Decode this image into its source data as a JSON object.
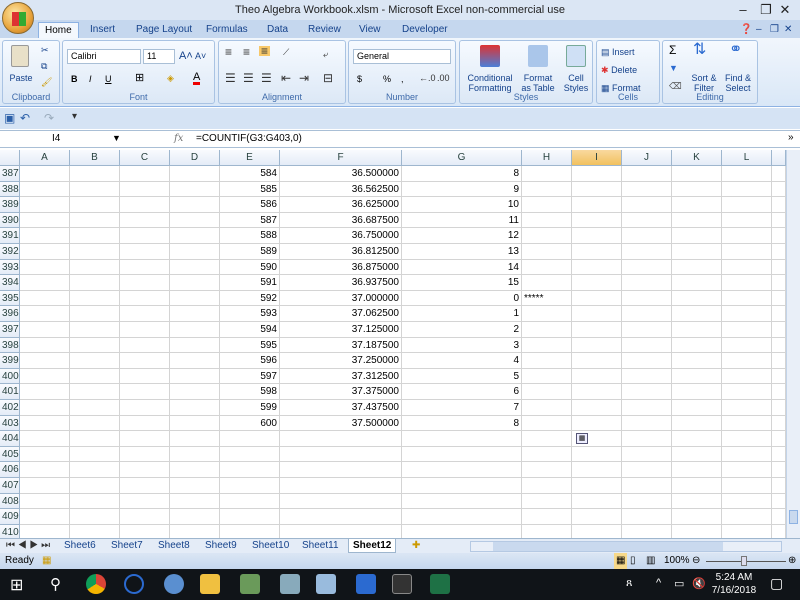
{
  "window": {
    "title": "Theo Algebra Workbook.xlsm - Microsoft Excel non-commercial use"
  },
  "ribbon": {
    "tabs": [
      "Home",
      "Insert",
      "Page Layout",
      "Formulas",
      "Data",
      "Review",
      "View",
      "Developer"
    ],
    "active_tab": "Home",
    "clipboard": {
      "label": "Clipboard",
      "paste": "Paste"
    },
    "font": {
      "label": "Font",
      "name": "Calibri",
      "size": "11",
      "bold": "B",
      "italic": "I",
      "underline": "U"
    },
    "alignment": {
      "label": "Alignment"
    },
    "number": {
      "label": "Number",
      "format": "General",
      "currency": "$",
      "percent": "%",
      "comma": ","
    },
    "styles": {
      "label": "Styles",
      "conditional": "Conditional Formatting",
      "format_table": "Format as Table",
      "cell_styles": "Cell Styles"
    },
    "cells": {
      "label": "Cells",
      "insert": "Insert",
      "delete": "Delete",
      "format": "Format"
    },
    "editing": {
      "label": "Editing",
      "sort": "Sort & Filter",
      "find": "Find & Select",
      "sum": "Σ"
    }
  },
  "formula_bar": {
    "name_box": "I4",
    "fx": "fx",
    "formula": "=COUNTIF(G3:G403,0)"
  },
  "columns": [
    "A",
    "B",
    "C",
    "D",
    "E",
    "F",
    "G",
    "H",
    "I",
    "J",
    "K",
    "L"
  ],
  "selected_column": "I",
  "rows": [
    {
      "n": "387",
      "E": "584",
      "F": "36.500000",
      "G": "8",
      "H": ""
    },
    {
      "n": "388",
      "E": "585",
      "F": "36.562500",
      "G": "9",
      "H": ""
    },
    {
      "n": "389",
      "E": "586",
      "F": "36.625000",
      "G": "10",
      "H": ""
    },
    {
      "n": "390",
      "E": "587",
      "F": "36.687500",
      "G": "11",
      "H": ""
    },
    {
      "n": "391",
      "E": "588",
      "F": "36.750000",
      "G": "12",
      "H": ""
    },
    {
      "n": "392",
      "E": "589",
      "F": "36.812500",
      "G": "13",
      "H": ""
    },
    {
      "n": "393",
      "E": "590",
      "F": "36.875000",
      "G": "14",
      "H": ""
    },
    {
      "n": "394",
      "E": "591",
      "F": "36.937500",
      "G": "15",
      "H": ""
    },
    {
      "n": "395",
      "E": "592",
      "F": "37.000000",
      "G": "0",
      "H": "*****"
    },
    {
      "n": "396",
      "E": "593",
      "F": "37.062500",
      "G": "1",
      "H": ""
    },
    {
      "n": "397",
      "E": "594",
      "F": "37.125000",
      "G": "2",
      "H": ""
    },
    {
      "n": "398",
      "E": "595",
      "F": "37.187500",
      "G": "3",
      "H": ""
    },
    {
      "n": "399",
      "E": "596",
      "F": "37.250000",
      "G": "4",
      "H": ""
    },
    {
      "n": "400",
      "E": "597",
      "F": "37.312500",
      "G": "5",
      "H": ""
    },
    {
      "n": "401",
      "E": "598",
      "F": "37.375000",
      "G": "6",
      "H": ""
    },
    {
      "n": "402",
      "E": "599",
      "F": "37.437500",
      "G": "7",
      "H": ""
    },
    {
      "n": "403",
      "E": "600",
      "F": "37.500000",
      "G": "8",
      "H": ""
    },
    {
      "n": "404",
      "E": "",
      "F": "",
      "G": "",
      "H": ""
    },
    {
      "n": "405",
      "E": "",
      "F": "",
      "G": "",
      "H": ""
    },
    {
      "n": "406",
      "E": "",
      "F": "",
      "G": "",
      "H": ""
    },
    {
      "n": "407",
      "E": "",
      "F": "",
      "G": "",
      "H": ""
    },
    {
      "n": "408",
      "E": "",
      "F": "",
      "G": "",
      "H": ""
    },
    {
      "n": "409",
      "E": "",
      "F": "",
      "G": "",
      "H": ""
    },
    {
      "n": "410",
      "E": "",
      "F": "",
      "G": "",
      "H": ""
    }
  ],
  "sheets": [
    "Sheet6",
    "Sheet7",
    "Sheet8",
    "Sheet9",
    "Sheet10",
    "Sheet11",
    "Sheet12"
  ],
  "active_sheet": "Sheet12",
  "status": {
    "ready": "Ready",
    "zoom": "100%"
  },
  "taskbar": {
    "time": "5:24 AM",
    "date": "7/16/2018"
  }
}
